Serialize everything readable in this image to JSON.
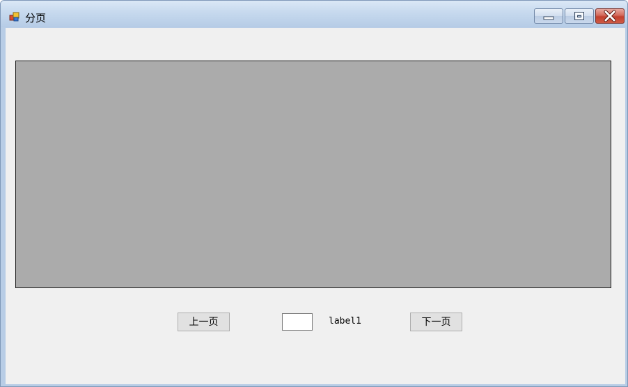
{
  "window": {
    "title": "分页",
    "icon": "winforms-app-icon",
    "controls": {
      "minimize_icon": "minimize-icon",
      "maximize_icon": "maximize-icon",
      "close_icon": "close-icon"
    }
  },
  "content": {
    "panel_color": "#ababab"
  },
  "pager": {
    "prev_label": "上一页",
    "page_input_value": "",
    "status_label": "label1",
    "next_label": "下一页"
  }
}
